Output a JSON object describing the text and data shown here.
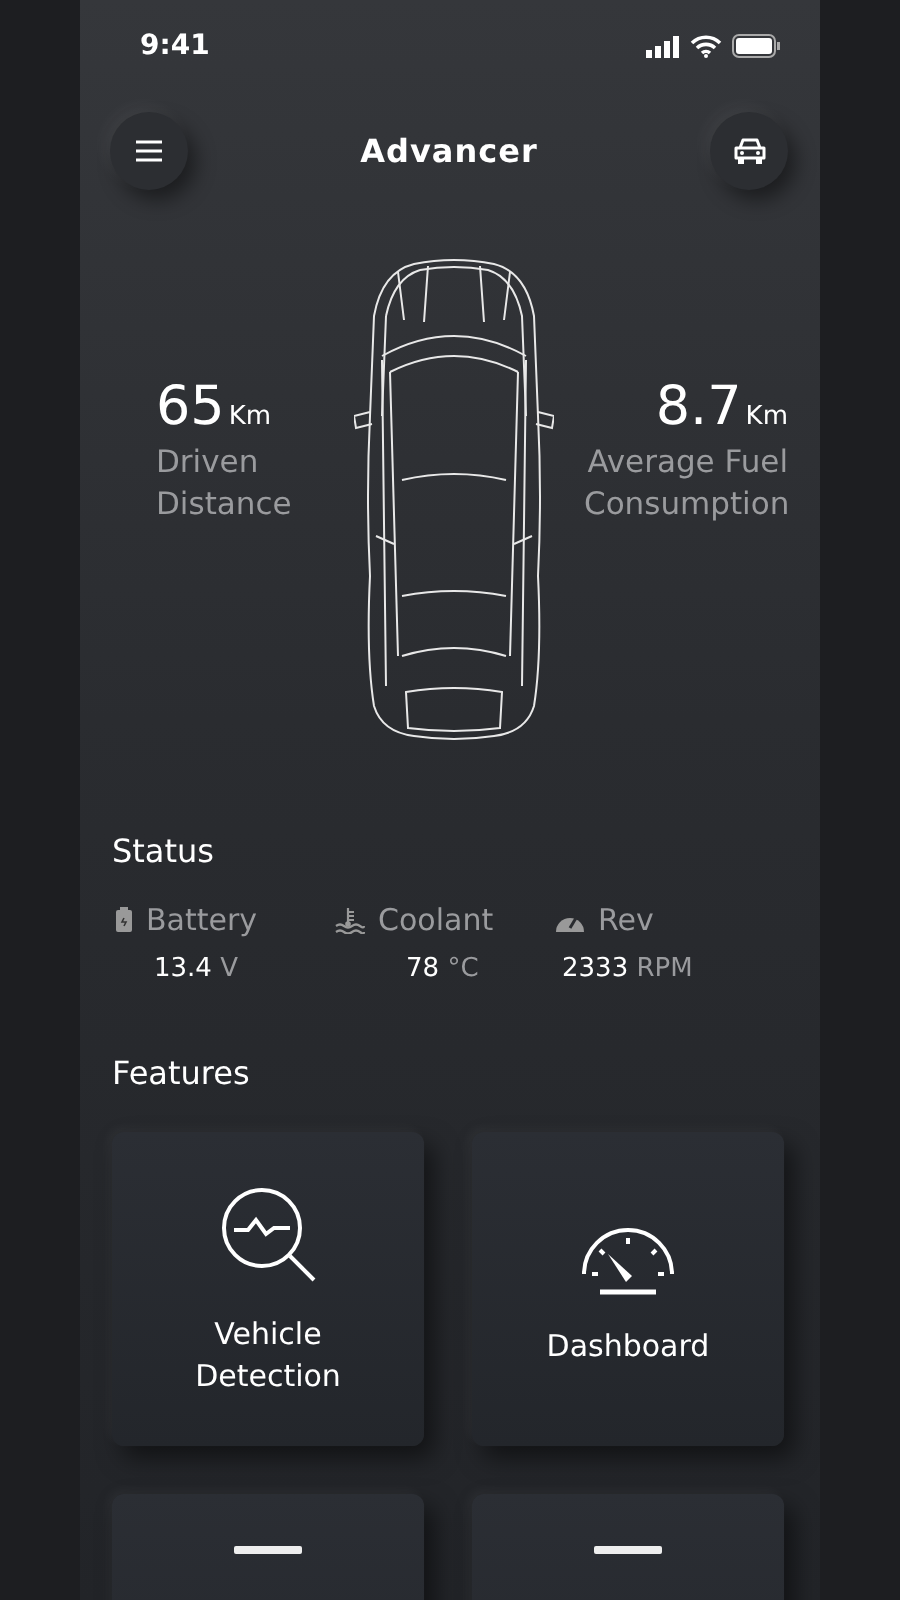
{
  "status_bar": {
    "time": "9:41"
  },
  "header": {
    "title": "Advancer"
  },
  "stats": [
    {
      "value": "65",
      "unit": "Km",
      "label": "Driven Distance"
    },
    {
      "value": "8.7",
      "unit": "Km",
      "label": "Average Fuel Consumption"
    }
  ],
  "status": {
    "heading": "Status",
    "items": [
      {
        "kind": "battery",
        "label": "Battery",
        "value": "13.4",
        "unit": "V"
      },
      {
        "kind": "coolant",
        "label": "Coolant",
        "value": "78",
        "unit": "°C"
      },
      {
        "kind": "rev",
        "label": "Rev",
        "value": "2333",
        "unit": "RPM"
      }
    ]
  },
  "features": {
    "heading": "Features",
    "items": [
      {
        "kind": "detection",
        "label": "Vehicle Detection"
      },
      {
        "kind": "dashboard",
        "label": "Dashboard"
      },
      {
        "kind": "cut"
      },
      {
        "kind": "cut"
      }
    ]
  }
}
